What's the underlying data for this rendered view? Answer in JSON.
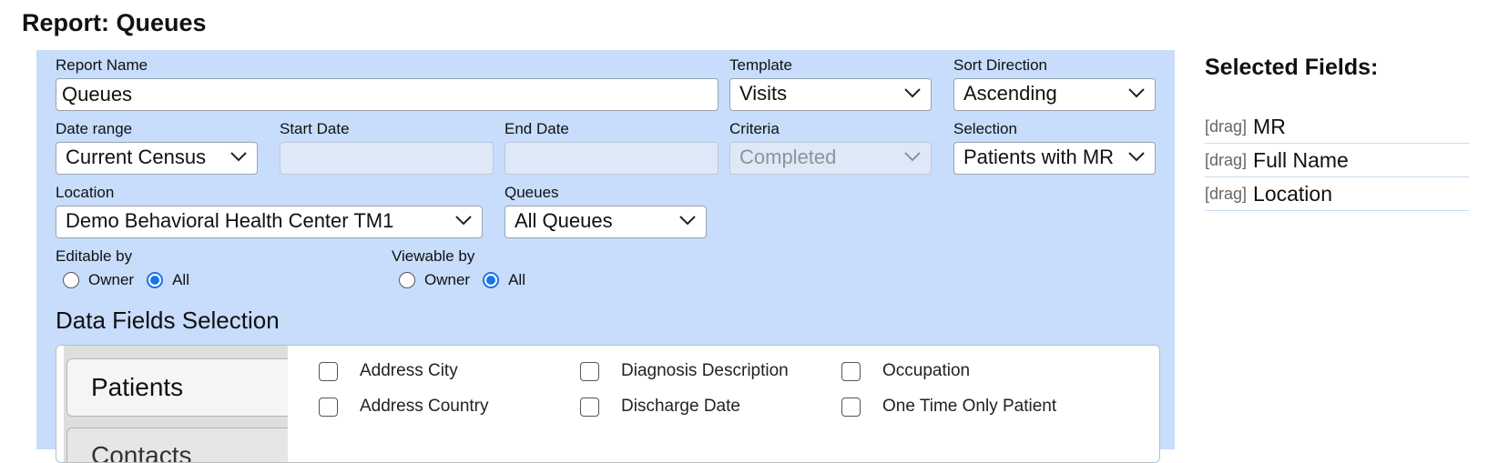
{
  "page": {
    "title": "Report: Queues"
  },
  "form": {
    "report_name": {
      "label": "Report Name",
      "value": "Queues"
    },
    "template": {
      "label": "Template",
      "value": "Visits"
    },
    "sort_direction": {
      "label": "Sort Direction",
      "value": "Ascending"
    },
    "date_range": {
      "label": "Date range",
      "value": "Current Census"
    },
    "start_date": {
      "label": "Start Date",
      "value": ""
    },
    "end_date": {
      "label": "End Date",
      "value": ""
    },
    "criteria": {
      "label": "Criteria",
      "value": "Completed"
    },
    "selection": {
      "label": "Selection",
      "value": "Patients with MR"
    },
    "location": {
      "label": "Location",
      "value": "Demo Behavioral Health Center TM1"
    },
    "queues": {
      "label": "Queues",
      "value": "All Queues"
    },
    "editable_by": {
      "label": "Editable by",
      "options": [
        "Owner",
        "All"
      ],
      "selected": "All"
    },
    "viewable_by": {
      "label": "Viewable by",
      "options": [
        "Owner",
        "All"
      ],
      "selected": "All"
    }
  },
  "data_fields": {
    "title": "Data Fields Selection",
    "tabs": [
      "Patients",
      "Contacts"
    ],
    "active_tab": "Patients",
    "fields": [
      {
        "label": "Address City",
        "checked": false
      },
      {
        "label": "Address Country",
        "checked": false
      },
      {
        "label": "Diagnosis Description",
        "checked": false
      },
      {
        "label": "Discharge Date",
        "checked": false
      },
      {
        "label": "Occupation",
        "checked": false
      },
      {
        "label": "One Time Only Patient",
        "checked": false
      }
    ]
  },
  "selected_fields": {
    "title": "Selected Fields:",
    "drag_label": "[drag]",
    "items": [
      "MR",
      "Full Name",
      "Location"
    ]
  },
  "colors": {
    "panel_bg": "#c8dcfb",
    "accent": "#1a73e8"
  },
  "icons": {
    "select_arrow": "chevron-down-icon"
  }
}
